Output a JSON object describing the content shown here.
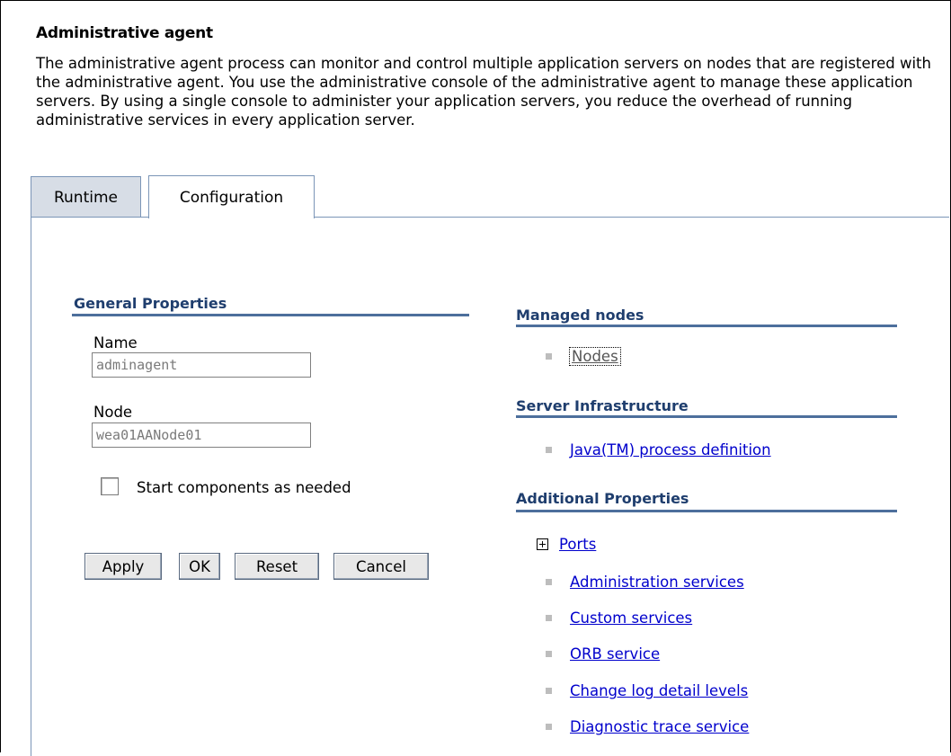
{
  "page": {
    "title": "Administrative agent",
    "description": "The administrative agent process can monitor and control multiple application servers on nodes that are registered with the administrative agent. You use the administrative console of the administrative agent to manage these application servers. By using a single console to administer your application servers, you reduce the overhead of running administrative services in every application server."
  },
  "tabs": [
    {
      "label": "Runtime",
      "selected": false
    },
    {
      "label": "Configuration",
      "selected": true
    }
  ],
  "general": {
    "heading": "General Properties",
    "name_label": "Name",
    "name_value": "adminagent",
    "node_label": "Node",
    "node_value": "wea01AANode01",
    "checkbox_label": "Start components as needed",
    "checkbox_checked": false
  },
  "buttons": {
    "apply": "Apply",
    "ok": "OK",
    "reset": "Reset",
    "cancel": "Cancel"
  },
  "managed_nodes": {
    "heading": "Managed nodes",
    "items": [
      "Nodes"
    ]
  },
  "server_infrastructure": {
    "heading": "Server Infrastructure",
    "items": [
      "Java(TM) process definition"
    ]
  },
  "additional_properties": {
    "heading": "Additional Properties",
    "expandable": "Ports",
    "items": [
      "Administration services",
      "Custom services",
      "ORB service",
      "Change log detail levels",
      "Diagnostic trace service"
    ]
  },
  "colors": {
    "heading": "#1f3e6e",
    "rule": "#4d6f9c",
    "tab_border": "#7b95b7",
    "link": "#0000cc"
  }
}
